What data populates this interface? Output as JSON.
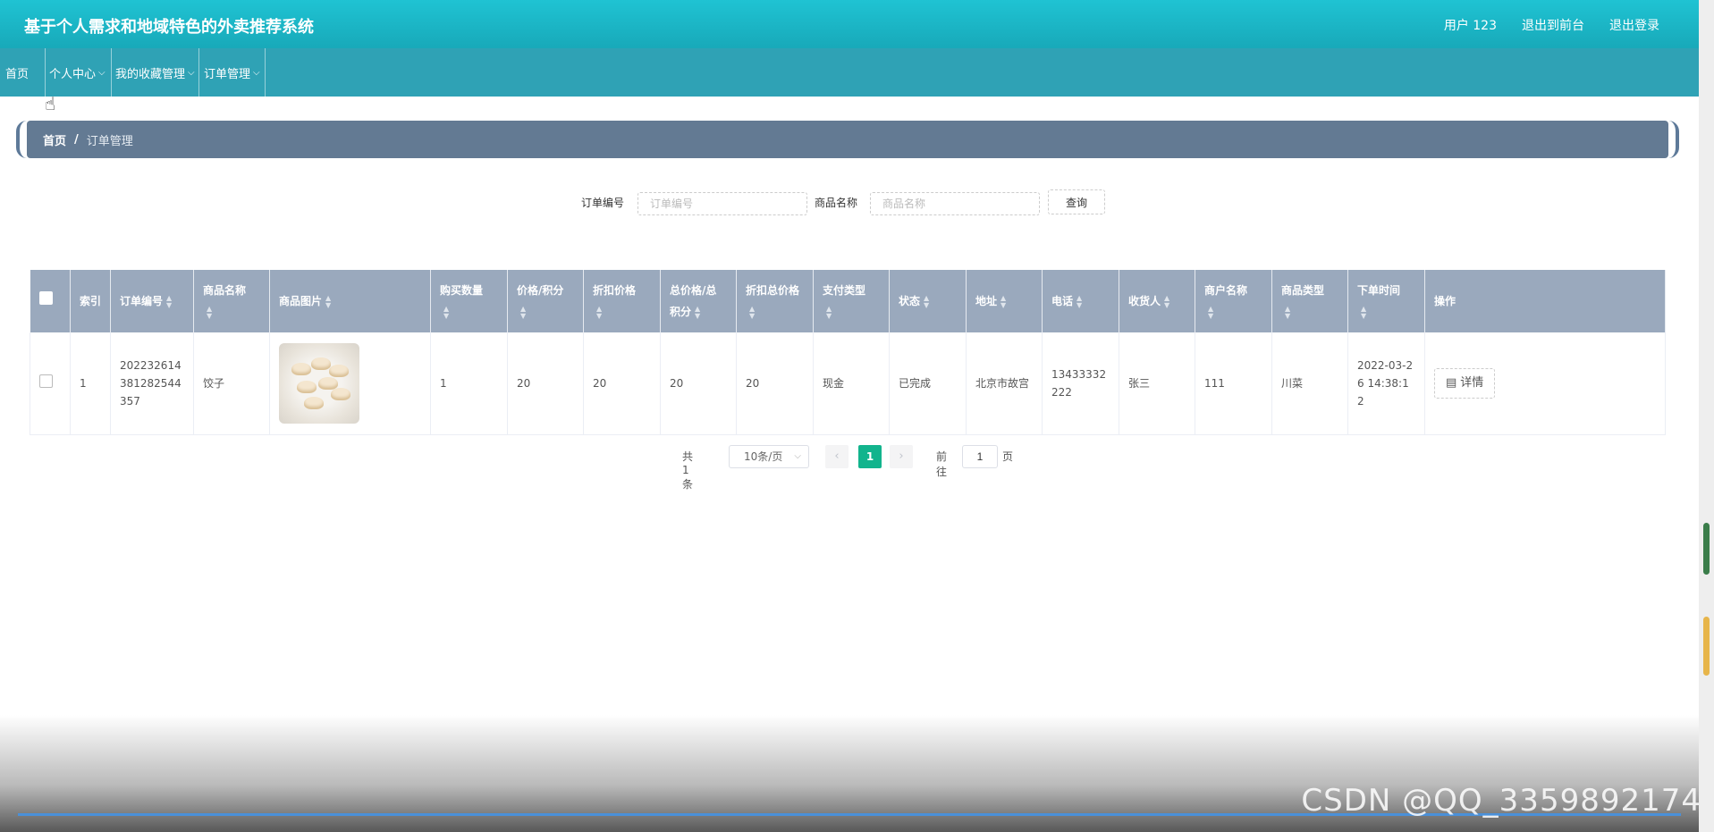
{
  "header": {
    "title": "基于个人需求和地域特色的外卖推荐系统",
    "links": [
      "用户 123",
      "退出到前台",
      "退出登录"
    ]
  },
  "nav": {
    "items": [
      {
        "label": "首页",
        "dropdown": false
      },
      {
        "label": "个人中心",
        "dropdown": true
      },
      {
        "label": "我的收藏管理",
        "dropdown": true
      },
      {
        "label": "订单管理",
        "dropdown": true
      }
    ]
  },
  "breadcrumb": {
    "home": "首页",
    "separator": "/",
    "current": "订单管理"
  },
  "search": {
    "order_no_label": "订单编号",
    "order_no_placeholder": "订单编号",
    "product_name_label": "商品名称",
    "product_name_placeholder": "商品名称",
    "query_label": "查询"
  },
  "table": {
    "columns": [
      "索引",
      "订单编号",
      "商品名称",
      "商品图片",
      "购买数量",
      "价格/积分",
      "折扣价格",
      "总价格/总积分",
      "折扣总价格",
      "支付类型",
      "状态",
      "地址",
      "电话",
      "收货人",
      "商户名称",
      "商品类型",
      "下单时间",
      "操作"
    ],
    "rows": [
      {
        "index": "1",
        "order_no": "202232614381282544357",
        "product_name": "饺子",
        "image": "dumplings-photo",
        "quantity": "1",
        "price": "20",
        "discount_price": "20",
        "total_price": "20",
        "discount_total": "20",
        "pay_type": "现金",
        "status": "已完成",
        "address": "北京市故宫",
        "phone": "13433332222",
        "receiver": "张三",
        "merchant": "111",
        "category": "川菜",
        "order_time": "2022-03-26 14:38:12",
        "action": "详情"
      }
    ]
  },
  "pagination": {
    "total": "共 1 条",
    "page_size": "10条/页",
    "current_page": "1",
    "goto_label": "前往",
    "goto_value": "1",
    "page_suffix": "页"
  },
  "watermark": "CSDN @QQ_3359892174",
  "colors": {
    "header": "#1fc3d3",
    "nav": "#2fa2b5",
    "breadcrumb": "#637a93",
    "table_header": "#9aa9bd",
    "active_page": "#12b48d"
  }
}
